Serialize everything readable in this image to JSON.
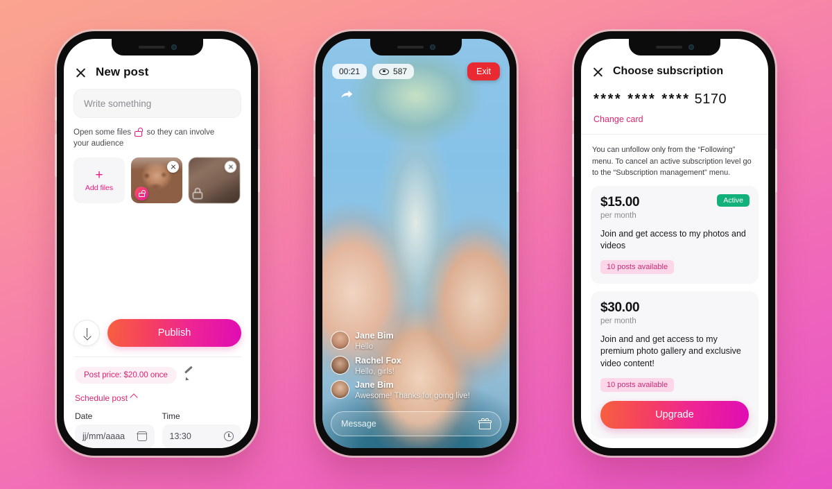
{
  "theme": {
    "accent_pink": "#e0246f",
    "accent_magenta": "#e00cb4",
    "accent_orange": "#f7603f",
    "active_green": "#12b07a",
    "exit_red": "#ea2a33",
    "bg_gradient_from": "#fba48f",
    "bg_gradient_to": "#e851c4"
  },
  "phone_new_post": {
    "close_label": "×",
    "title": "New post",
    "composer_placeholder": "Write something",
    "hint_text_before": "Open some files",
    "hint_text_after": "so they can involve your audience",
    "add_files_label": "Add files",
    "add_files_plus": "+",
    "publish_label": "Publish",
    "price_pill": "Post price: $20.00 once",
    "schedule_label": "Schedule post",
    "date_label": "Date",
    "date_value": "jj/mm/aaaa",
    "time_label": "Time",
    "time_value": "13:30"
  },
  "phone_live": {
    "timer": "00:21",
    "viewers": "587",
    "exit_label": "Exit",
    "messages": [
      {
        "name": "Jane Bim",
        "text": "Hello"
      },
      {
        "name": "Rachel Fox",
        "text": "Hello, girls!"
      },
      {
        "name": "Jane Bim",
        "text": "Awesome! Thanks for going live!"
      }
    ],
    "message_placeholder": "Message"
  },
  "phone_subscription": {
    "close_label": "×",
    "title": "Choose subscription",
    "card_masked": "**** **** ****",
    "card_last4": "5170",
    "change_card_label": "Change card",
    "note": "You can unfollow only from the “Following” menu. To cancel an active subscription level go to the “Subscription management” menu.",
    "plans": [
      {
        "price": "$15.00",
        "period": "per month",
        "description": "Join and get access to my photos and videos",
        "posts": "10 posts available",
        "badge": "Active"
      },
      {
        "price": "$30.00",
        "period": "per month",
        "description": "Join and and get access to my premium photo gallery and exclusive video content!",
        "posts": "10 posts available",
        "badge": null
      }
    ],
    "upgrade_label": "Upgrade"
  }
}
